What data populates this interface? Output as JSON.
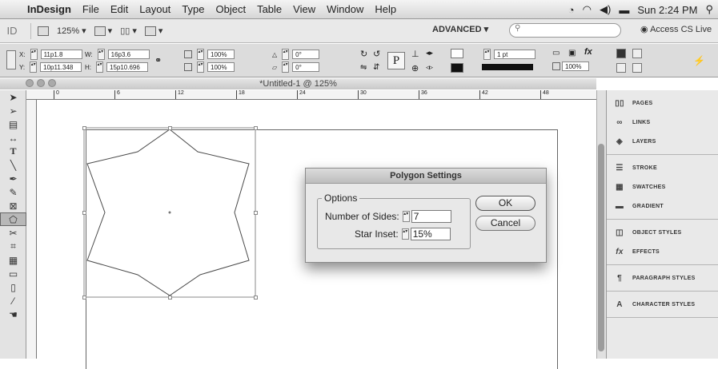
{
  "menubar": {
    "app": "InDesign",
    "items": [
      "File",
      "Edit",
      "Layout",
      "Type",
      "Object",
      "Table",
      "View",
      "Window",
      "Help"
    ],
    "clock": "Sun 2:24 PM"
  },
  "appbar": {
    "logo": "ID",
    "zoom": "125%",
    "workspace": "ADVANCED ▾",
    "search_placeholder": "",
    "access": "Access CS Live"
  },
  "control": {
    "x": "11p1.8",
    "y": "10p11.348",
    "w": "16p3.6",
    "h": "15p10.696",
    "scale_x": "100%",
    "scale_y": "100%",
    "rotate": "0°",
    "shear": "0°",
    "stroke_weight": "1 pt",
    "opacity": "100%",
    "x_label": "X:",
    "y_label": "Y:",
    "w_label": "W:",
    "h_label": "H:"
  },
  "document": {
    "title": "*Untitled-1 @ 125%"
  },
  "ruler": {
    "ticks": [
      "0",
      "6",
      "12",
      "18",
      "24",
      "30",
      "36",
      "42",
      "48"
    ]
  },
  "panels": [
    {
      "group": 1,
      "items": [
        {
          "label": "PAGES",
          "icon": "pages-icon"
        },
        {
          "label": "LINKS",
          "icon": "links-icon"
        },
        {
          "label": "LAYERS",
          "icon": "layers-icon"
        }
      ]
    },
    {
      "group": 2,
      "items": [
        {
          "label": "STROKE",
          "icon": "stroke-icon"
        },
        {
          "label": "SWATCHES",
          "icon": "swatches-icon"
        },
        {
          "label": "GRADIENT",
          "icon": "gradient-icon"
        }
      ]
    },
    {
      "group": 3,
      "items": [
        {
          "label": "OBJECT STYLES",
          "icon": "object-styles-icon"
        },
        {
          "label": "EFFECTS",
          "icon": "effects-icon"
        }
      ]
    },
    {
      "group": 4,
      "items": [
        {
          "label": "PARAGRAPH STYLES",
          "icon": "paragraph-styles-icon"
        }
      ]
    },
    {
      "group": 5,
      "items": [
        {
          "label": "CHARACTER STYLES",
          "icon": "character-styles-icon"
        }
      ]
    }
  ],
  "dialog": {
    "title": "Polygon Settings",
    "options_label": "Options",
    "sides_label": "Number of Sides:",
    "sides_value": "7",
    "inset_label": "Star Inset:",
    "inset_value": "15%",
    "ok": "OK",
    "cancel": "Cancel"
  }
}
